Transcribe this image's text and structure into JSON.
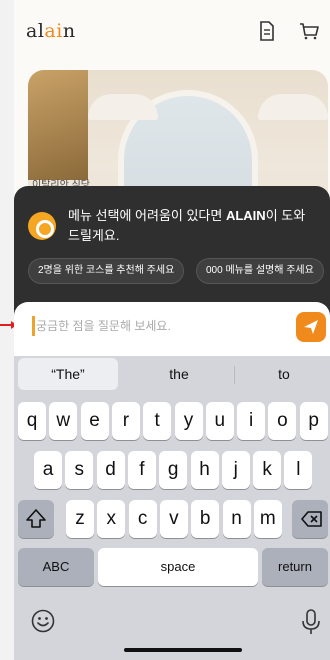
{
  "app": {
    "logo_pre": "al",
    "logo_hl": "ai",
    "logo_post": "n",
    "hero_label": "이탈리안 식당"
  },
  "header": {
    "doc_icon": "document-icon",
    "cart_icon": "cart-icon"
  },
  "chat": {
    "message_pre": "메뉴 선택에 어려움이 있다면 ",
    "message_brand": "ALAIN",
    "message_post": "이 도와 드릴게요.",
    "chips": [
      "2명을 위한 코스를 추천해 주세요",
      "000 메뉴를 설명해 주세요"
    ],
    "input_placeholder": "궁금한 점을 질문해 보세요.",
    "send_icon": "send-icon"
  },
  "keyboard": {
    "suggestions": [
      "“The”",
      "the",
      "to"
    ],
    "row1": [
      "q",
      "w",
      "e",
      "r",
      "t",
      "y",
      "u",
      "i",
      "o",
      "p"
    ],
    "row2": [
      "a",
      "s",
      "d",
      "f",
      "g",
      "h",
      "j",
      "k",
      "l"
    ],
    "row3": [
      "z",
      "x",
      "c",
      "v",
      "b",
      "n",
      "m"
    ],
    "abc_label": "ABC",
    "space_label": "space",
    "return_label": "return",
    "shift_icon": "shift-icon",
    "delete_icon": "delete-icon",
    "emoji_icon": "emoji-icon",
    "mic_icon": "microphone-icon"
  },
  "colors": {
    "accent": "#f08a1c",
    "overlay": "#2f2f2f",
    "keyboard_bg": "#d3d5db"
  }
}
